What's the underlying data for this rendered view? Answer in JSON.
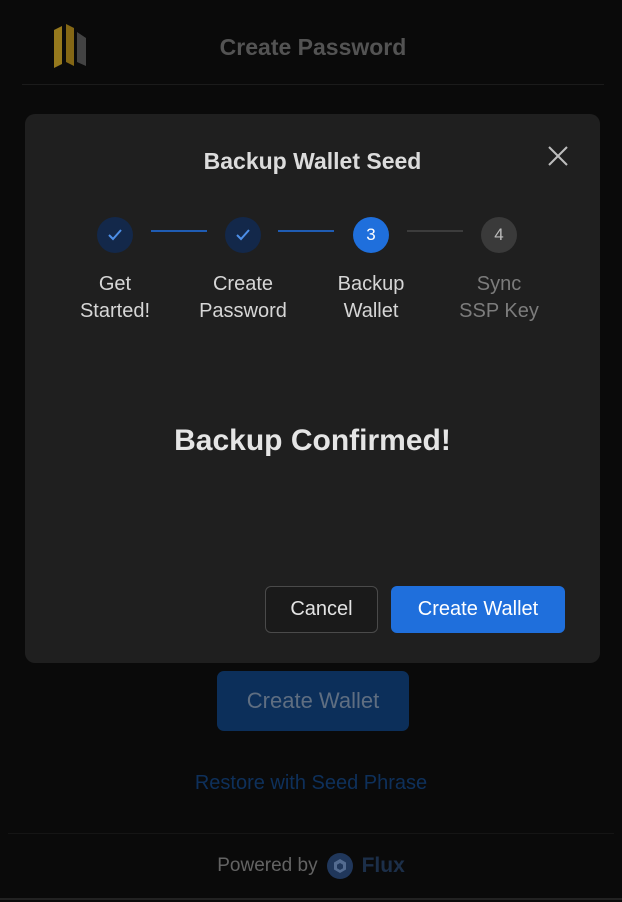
{
  "header": {
    "title": "Create Password",
    "logo_icon": "ssp-logo-icon"
  },
  "background": {
    "create_wallet_label": "Create Wallet",
    "restore_link": "Restore with Seed Phrase"
  },
  "footer": {
    "powered_by": "Powered by",
    "brand": "Flux",
    "brand_icon": "flux-logo-icon"
  },
  "modal": {
    "title": "Backup Wallet Seed",
    "close_icon": "close-icon",
    "steps": [
      {
        "number": "",
        "line1": "Get",
        "line2": "Started!",
        "state": "done",
        "icon": "check-icon"
      },
      {
        "number": "",
        "line1": "Create",
        "line2": "Password",
        "state": "done",
        "icon": "check-icon"
      },
      {
        "number": "3",
        "line1": "Backup",
        "line2": "Wallet",
        "state": "active"
      },
      {
        "number": "4",
        "line1": "Sync",
        "line2": "SSP Key",
        "state": "todo"
      }
    ],
    "message": "Backup Confirmed!",
    "cancel_label": "Cancel",
    "create_label": "Create Wallet"
  },
  "colors": {
    "accent": "#1f6fdc",
    "modal_bg": "#1f1f1f",
    "page_bg": "#0e0e0e",
    "logo_gold": "#c9a227"
  }
}
